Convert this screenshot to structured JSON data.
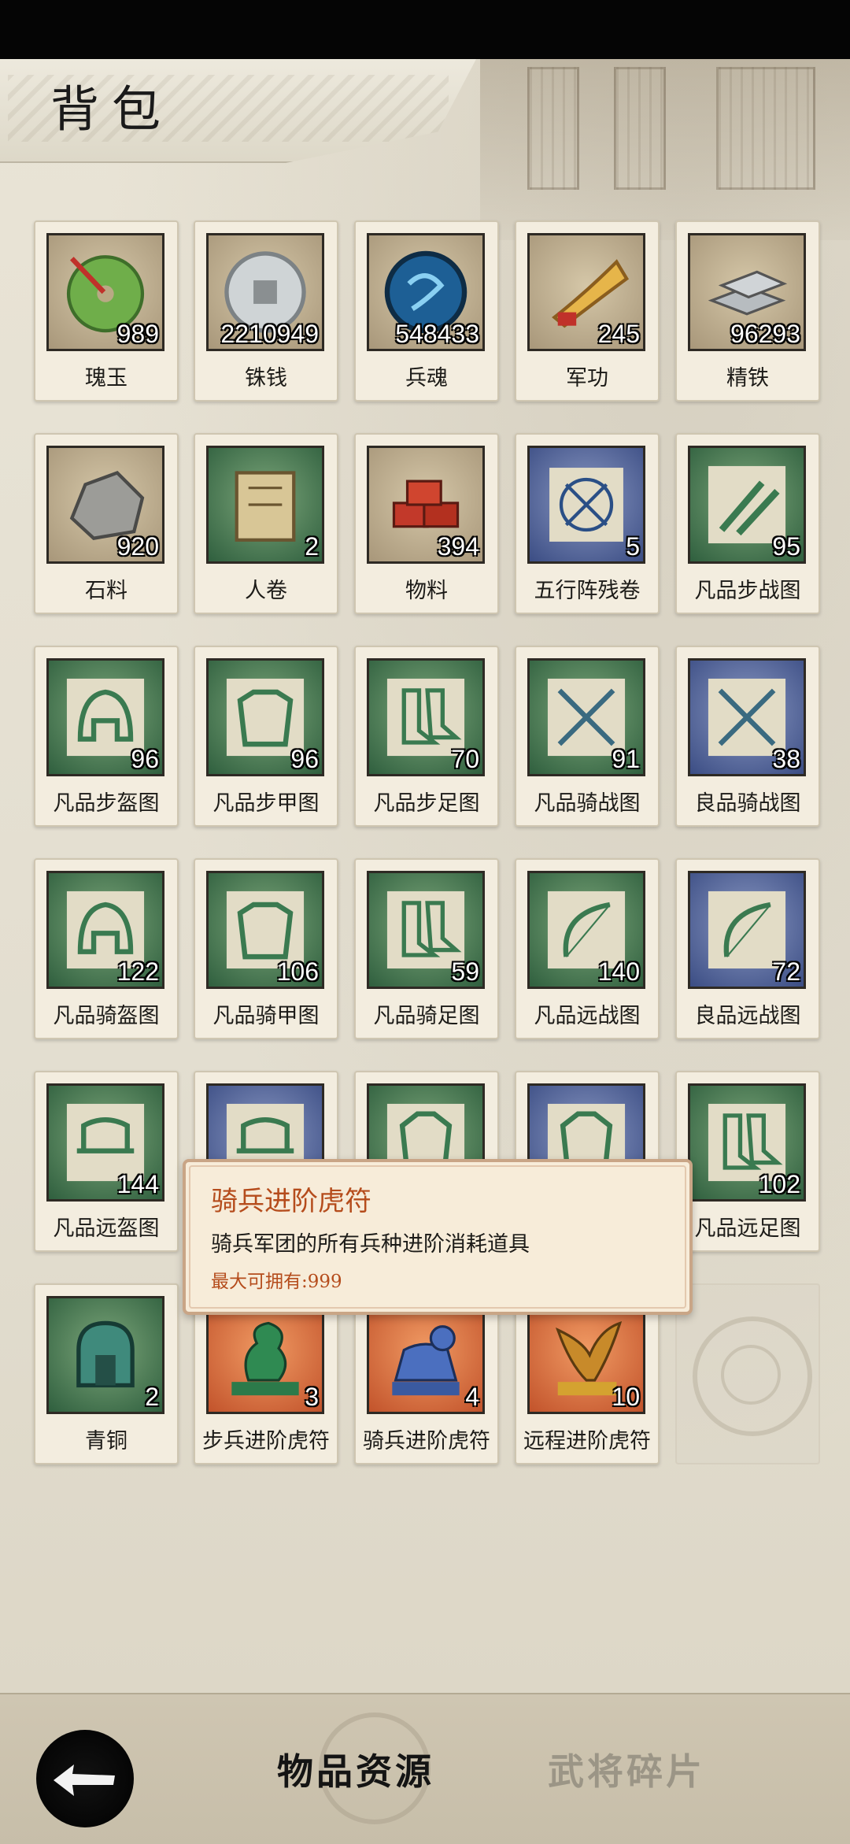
{
  "header": {
    "title": "背包"
  },
  "items": [
    {
      "name": "瑰玉",
      "count": "989",
      "color": "brown",
      "icon": "jade-disc-icon"
    },
    {
      "name": "铢钱",
      "count": "2210949",
      "color": "brown",
      "icon": "coin-icon"
    },
    {
      "name": "兵魂",
      "count": "548433",
      "color": "brown",
      "icon": "soul-medallion-icon"
    },
    {
      "name": "军功",
      "count": "245",
      "color": "brown",
      "icon": "horn-icon"
    },
    {
      "name": "精铁",
      "count": "96293",
      "color": "brown",
      "icon": "iron-ingot-icon"
    },
    {
      "name": "石料",
      "count": "920",
      "color": "brown",
      "icon": "stone-icon"
    },
    {
      "name": "人卷",
      "count": "2",
      "color": "green",
      "icon": "scroll-icon"
    },
    {
      "name": "物料",
      "count": "394",
      "color": "brown",
      "icon": "bricks-icon"
    },
    {
      "name": "五行阵残卷",
      "count": "5",
      "color": "blue",
      "icon": "formation-map-icon"
    },
    {
      "name": "凡品步战图",
      "count": "95",
      "color": "green",
      "icon": "blades-blueprint-icon"
    },
    {
      "name": "凡品步盔图",
      "count": "96",
      "color": "green",
      "icon": "helmet-blueprint-icon"
    },
    {
      "name": "凡品步甲图",
      "count": "96",
      "color": "green",
      "icon": "armor-blueprint-icon"
    },
    {
      "name": "凡品步足图",
      "count": "70",
      "color": "green",
      "icon": "boots-blueprint-icon"
    },
    {
      "name": "凡品骑战图",
      "count": "91",
      "color": "green",
      "icon": "crossed-swords-blueprint-icon"
    },
    {
      "name": "良品骑战图",
      "count": "38",
      "color": "blue",
      "icon": "crossed-swords-blueprint-icon"
    },
    {
      "name": "凡品骑盔图",
      "count": "122",
      "color": "green",
      "icon": "helmet-blueprint-icon"
    },
    {
      "name": "凡品骑甲图",
      "count": "106",
      "color": "green",
      "icon": "armor-blueprint-icon"
    },
    {
      "name": "凡品骑足图",
      "count": "59",
      "color": "green",
      "icon": "boots-blueprint-icon"
    },
    {
      "name": "凡品远战图",
      "count": "140",
      "color": "green",
      "icon": "bow-blueprint-icon"
    },
    {
      "name": "良品远战图",
      "count": "72",
      "color": "blue",
      "icon": "bow-blueprint-icon"
    },
    {
      "name": "凡品远盔图",
      "count": "144",
      "color": "green",
      "icon": "hat-blueprint-icon"
    },
    {
      "name": "",
      "count": "",
      "color": "blue",
      "icon": "hat-blueprint-icon"
    },
    {
      "name": "",
      "count": "",
      "color": "green",
      "icon": "robe-blueprint-icon"
    },
    {
      "name": "",
      "count": "",
      "color": "blue",
      "icon": "robe-blueprint-icon"
    },
    {
      "name": "凡品远足图",
      "count": "102",
      "color": "green",
      "icon": "boots-blueprint-icon"
    },
    {
      "name": "青铜",
      "count": "2",
      "color": "green",
      "icon": "bronze-icon"
    },
    {
      "name": "步兵进阶虎符",
      "count": "3",
      "color": "orange",
      "icon": "dragon-tally-icon"
    },
    {
      "name": "骑兵进阶虎符",
      "count": "4",
      "color": "orange",
      "icon": "tiger-tally-icon"
    },
    {
      "name": "远程进阶虎符",
      "count": "10",
      "color": "orange",
      "icon": "eagle-tally-icon"
    }
  ],
  "tooltip": {
    "title": "骑兵进阶虎符",
    "description": "骑兵军团的所有兵种进阶消耗道具",
    "max": "最大可拥有:999"
  },
  "bottom_tabs": {
    "items": "物品资源",
    "generals": "武将碎片"
  },
  "colors": {
    "tooltip_title": "#b54c1c",
    "tab_active": "#141414",
    "tab_inactive": "#9b9586"
  }
}
